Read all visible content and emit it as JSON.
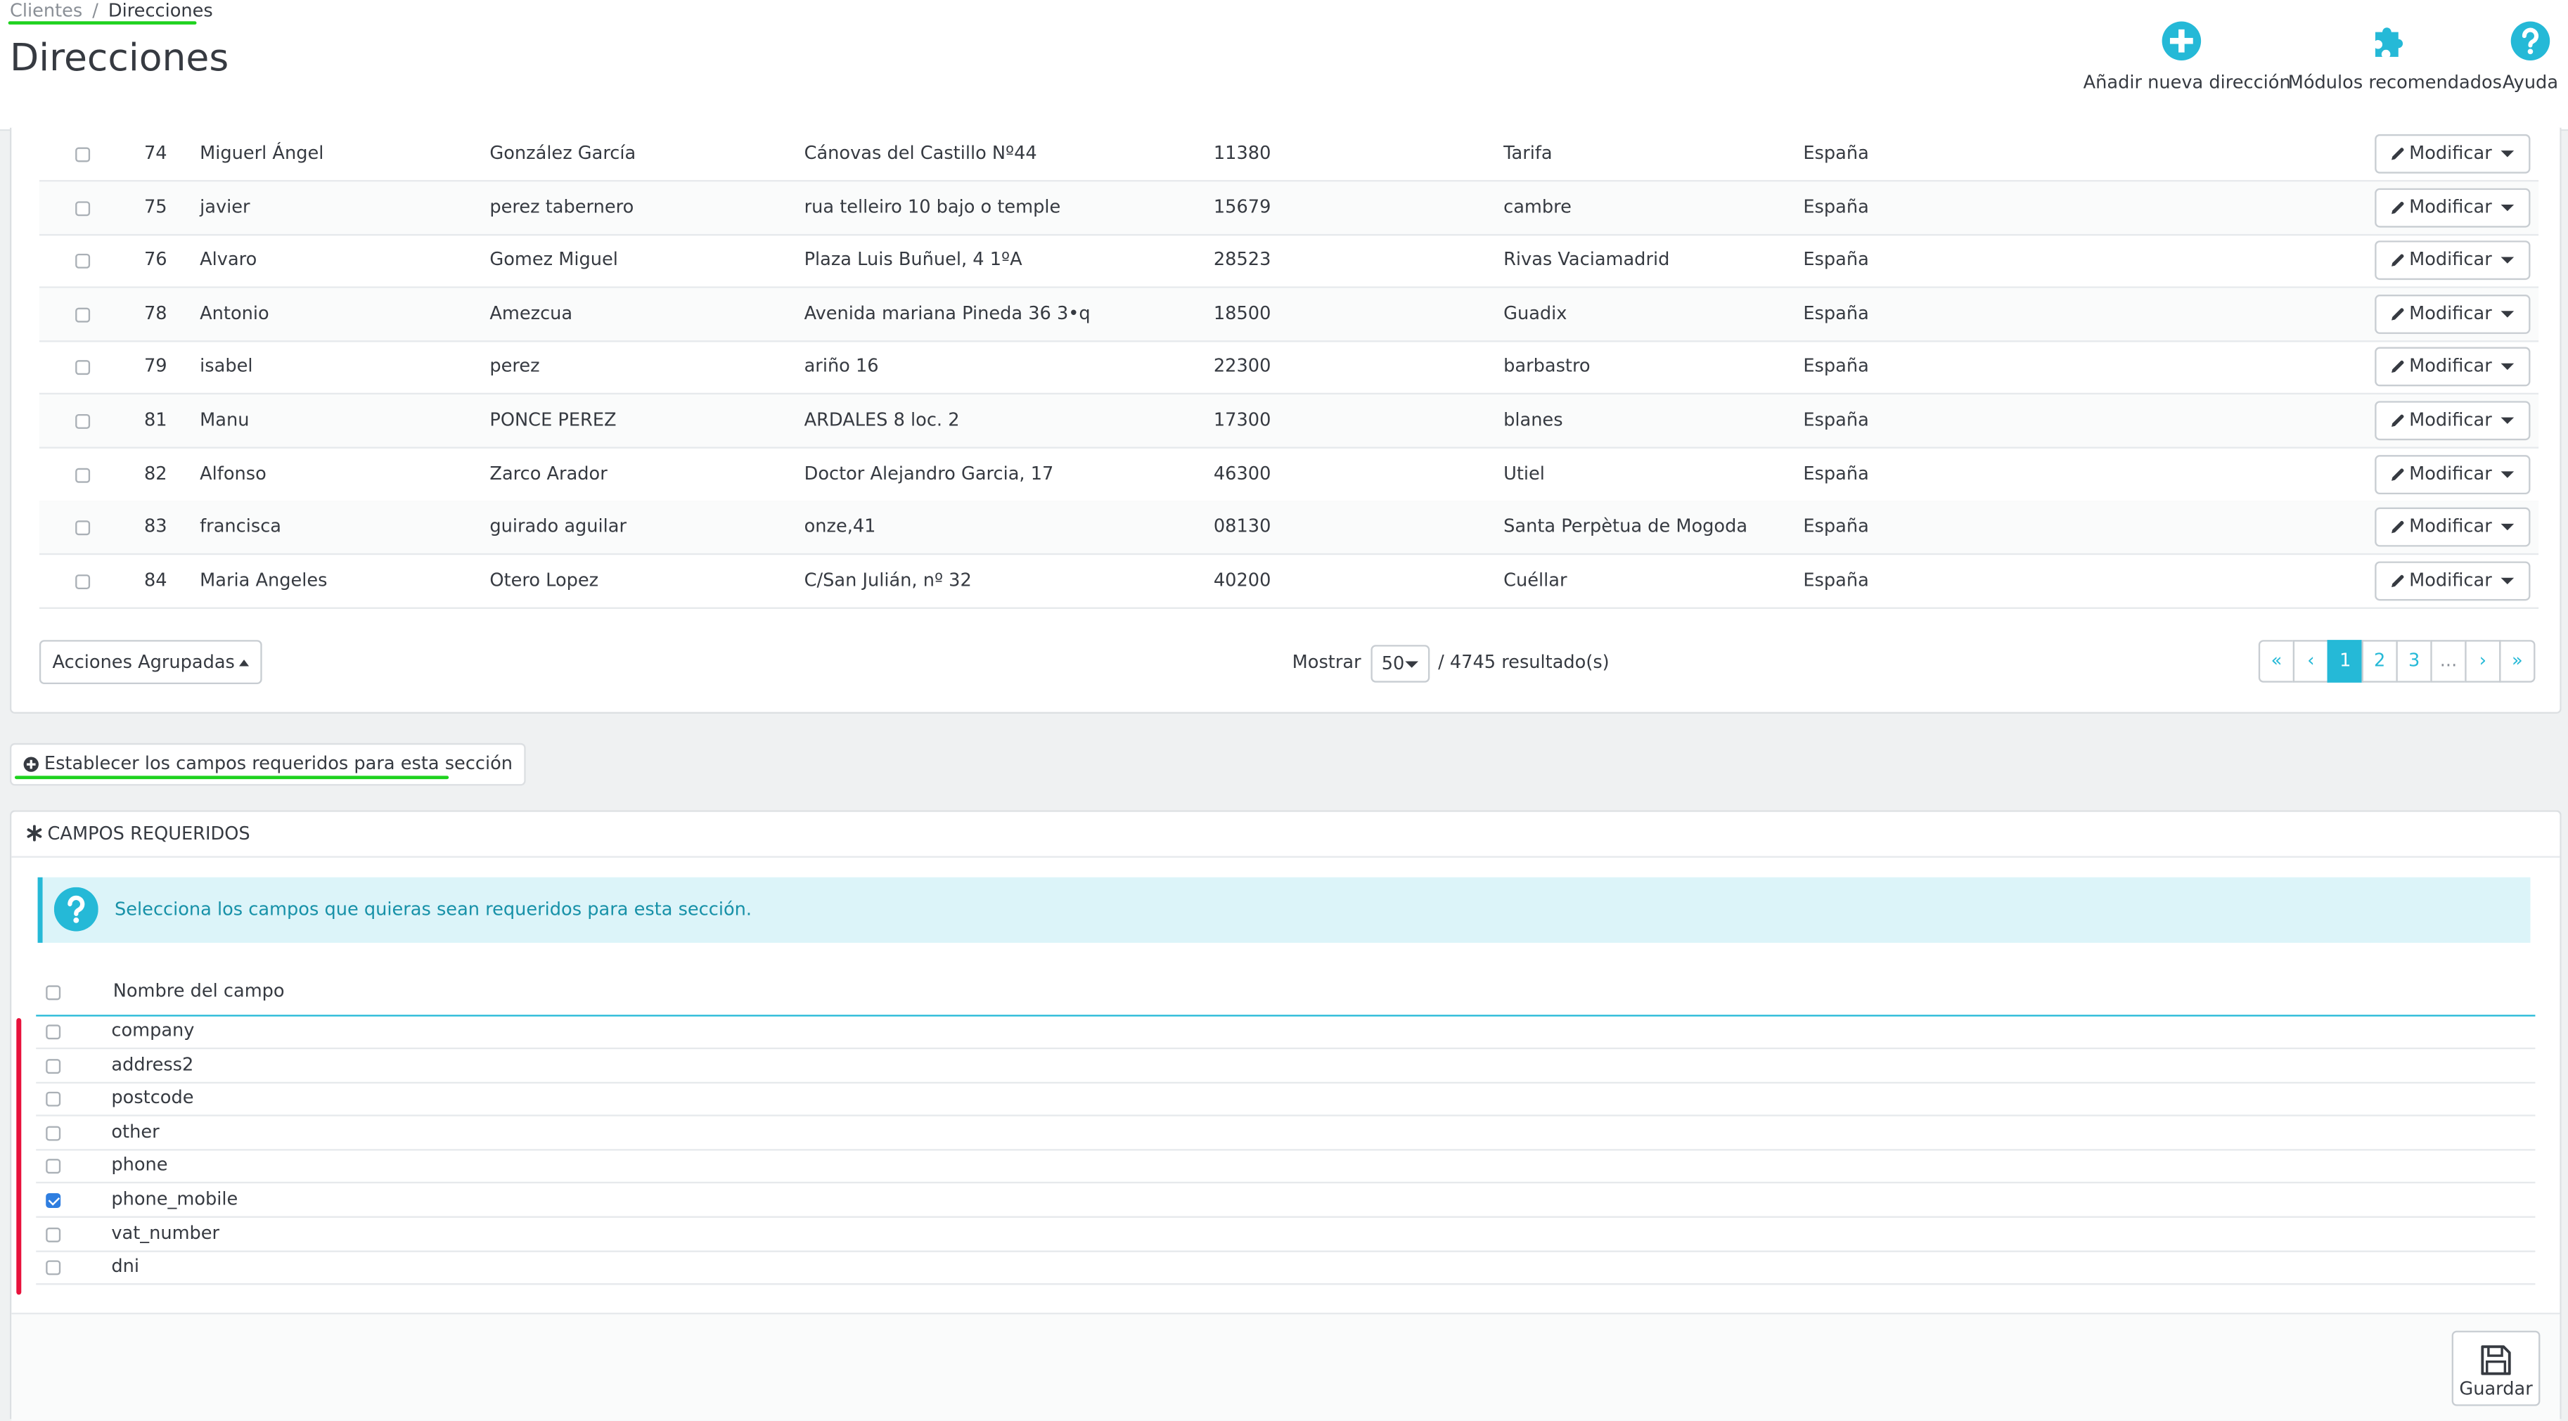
{
  "breadcrumb": {
    "parent": "Clientes",
    "separator": "/",
    "current": "Direcciones"
  },
  "page_title": "Direcciones",
  "toolbar": {
    "add_label": "Añadir nueva dirección",
    "modules_label": "Módulos recomendados",
    "help_label": "Ayuda"
  },
  "colors": {
    "accent": "#25b9d7",
    "highlight_green": "#1ed21e",
    "highlight_red": "#e8123c",
    "check_blue": "#2f7ee0"
  },
  "icons": {
    "add": "plus-circle-icon",
    "modules": "puzzle-icon",
    "help": "question-circle-icon",
    "edit": "pencil-icon",
    "required": "asterisk-icon",
    "save": "floppy-disk-icon"
  },
  "addresses": {
    "edit_label": "Modificar",
    "rows": [
      {
        "id": "74",
        "firstname": "Miguerl Ángel",
        "lastname": "González García",
        "address": "Cánovas del Castillo Nº44",
        "postcode": "11380",
        "city": "Tarifa",
        "country": "España"
      },
      {
        "id": "75",
        "firstname": "javier",
        "lastname": "perez tabernero",
        "address": "rua telleiro 10 bajo o temple",
        "postcode": "15679",
        "city": "cambre",
        "country": "España"
      },
      {
        "id": "76",
        "firstname": "Alvaro",
        "lastname": "Gomez Miguel",
        "address": "Plaza Luis Buñuel, 4 1ºA",
        "postcode": "28523",
        "city": "Rivas Vaciamadrid",
        "country": "España"
      },
      {
        "id": "78",
        "firstname": "Antonio",
        "lastname": "Amezcua",
        "address": "Avenida mariana Pineda 36 3•q",
        "postcode": "18500",
        "city": "Guadix",
        "country": "España"
      },
      {
        "id": "79",
        "firstname": "isabel",
        "lastname": "perez",
        "address": "ariño 16",
        "postcode": "22300",
        "city": "barbastro",
        "country": "España"
      },
      {
        "id": "81",
        "firstname": "Manu",
        "lastname": "PONCE PEREZ",
        "address": "ARDALES 8 loc. 2",
        "postcode": "17300",
        "city": "blanes",
        "country": "España"
      },
      {
        "id": "82",
        "firstname": "Alfonso",
        "lastname": "Zarco Arador",
        "address": "Doctor Alejandro Garcia, 17",
        "postcode": "46300",
        "city": "Utiel",
        "country": "España"
      },
      {
        "id": "83",
        "firstname": "francisca",
        "lastname": "guirado aguilar",
        "address": "onze,41",
        "postcode": "08130",
        "city": "Santa Perpètua de Mogoda",
        "country": "España"
      },
      {
        "id": "84",
        "firstname": "Maria Angeles",
        "lastname": "Otero Lopez",
        "address": "C/San Julián, nº 32",
        "postcode": "40200",
        "city": "Cuéllar",
        "country": "España"
      }
    ]
  },
  "list_footer": {
    "bulk_label": "Acciones Agrupadas",
    "show_label": "Mostrar",
    "per_page": "50",
    "results": "/ 4745 resultado(s)",
    "pages": [
      "«",
      "‹",
      "1",
      "2",
      "3",
      "...",
      "›",
      "»"
    ],
    "active_page": "1"
  },
  "required_fields": {
    "toggle_label": "Establecer los campos requeridos para esta sección",
    "panel_title": "Campos requeridos",
    "info_text": "Selecciona los campos que quieras sean requeridos para esta sección.",
    "column_header": "Nombre del campo",
    "fields": [
      {
        "name": "company",
        "checked": false
      },
      {
        "name": "address2",
        "checked": false
      },
      {
        "name": "postcode",
        "checked": false
      },
      {
        "name": "other",
        "checked": false
      },
      {
        "name": "phone",
        "checked": false
      },
      {
        "name": "phone_mobile",
        "checked": true
      },
      {
        "name": "vat_number",
        "checked": false
      },
      {
        "name": "dni",
        "checked": false
      }
    ],
    "save_label": "Guardar"
  }
}
